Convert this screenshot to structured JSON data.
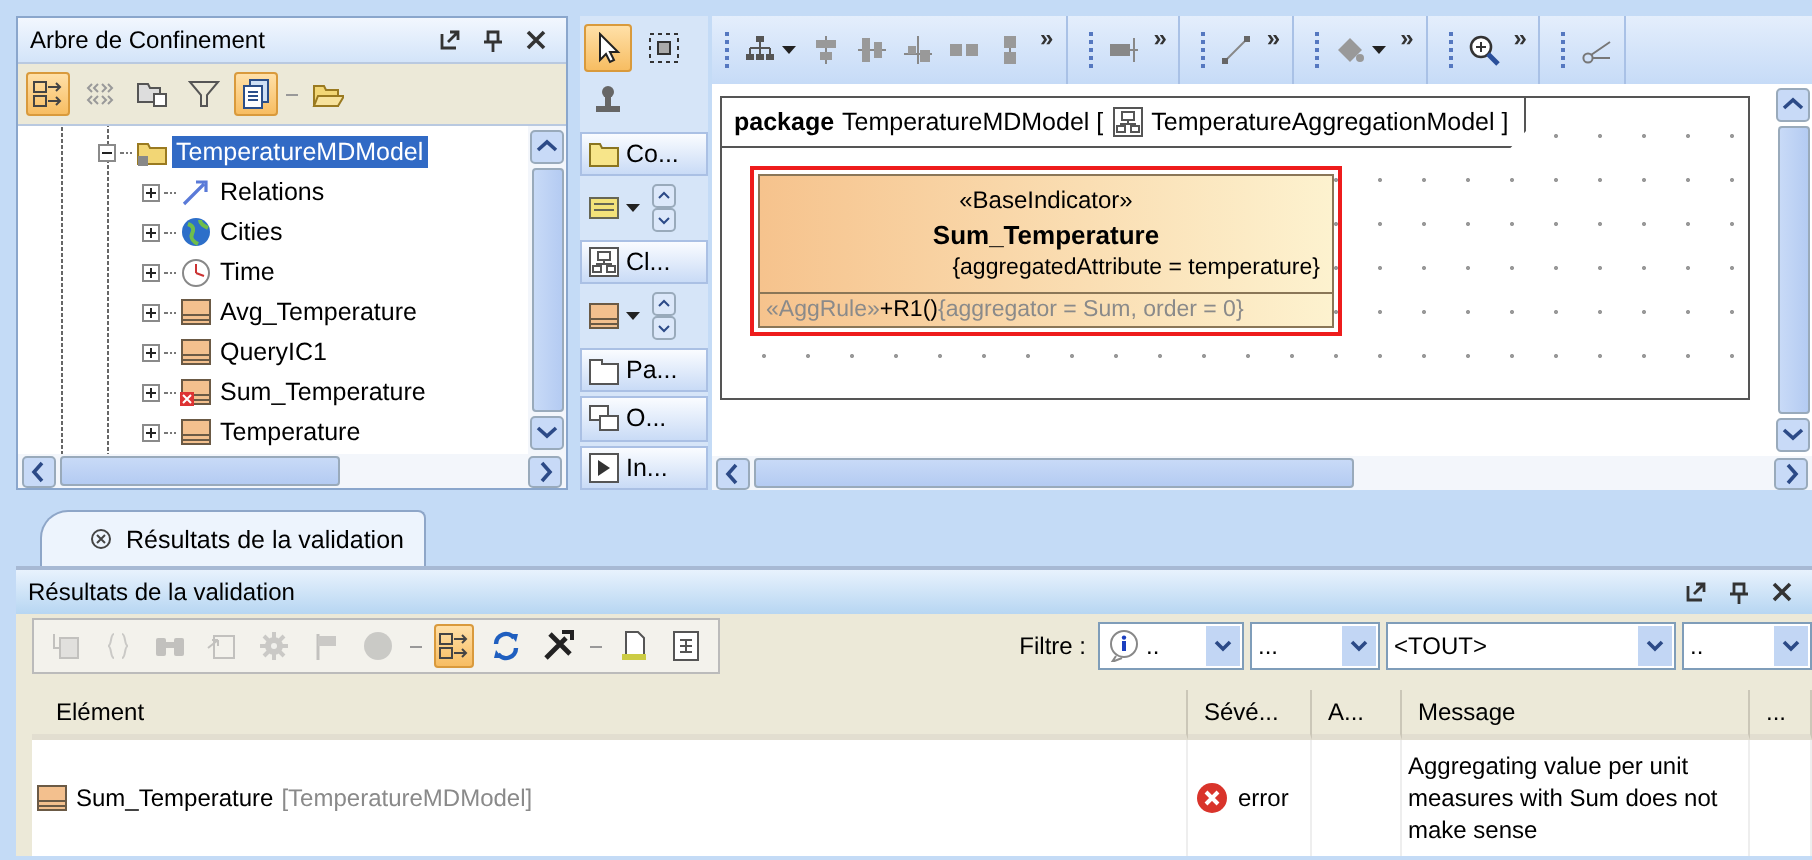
{
  "containment_tree": {
    "title": "Arbre de Confinement",
    "tool_groups": [
      [
        {
          "kind": "split-list",
          "on": true
        },
        {
          "kind": "chevrons",
          "on": false
        },
        {
          "kind": "folder-tree",
          "on": false
        },
        {
          "kind": "filter",
          "on": false
        },
        {
          "kind": "document-stack",
          "on": true
        }
      ],
      [
        {
          "kind": "open-folder",
          "on": false
        }
      ]
    ],
    "items": [
      {
        "label": "TemperatureMDModel",
        "kind": "package",
        "selected": true,
        "expanded": true,
        "children": [
          {
            "label": "Relations",
            "kind": "arrow",
            "selected": false,
            "expanded": false
          },
          {
            "label": "Cities",
            "kind": "globe",
            "selected": false,
            "expanded": false
          },
          {
            "label": "Time",
            "kind": "clock",
            "selected": false,
            "expanded": false
          },
          {
            "label": "Avg_Temperature",
            "kind": "class",
            "selected": false,
            "expanded": false
          },
          {
            "label": "QueryIC1",
            "kind": "class",
            "selected": false,
            "expanded": false
          },
          {
            "label": "Sum_Temperature",
            "kind": "error-class",
            "selected": false,
            "expanded": false
          },
          {
            "label": "Temperature",
            "kind": "class",
            "selected": false,
            "expanded": false
          }
        ]
      }
    ]
  },
  "palette": {
    "tools": [
      {
        "kind": "pointer",
        "selected": true
      },
      {
        "kind": "marquee",
        "selected": false
      },
      {
        "kind": "stamp",
        "selected": false
      }
    ],
    "rows": [
      {
        "kind": "category",
        "label": "Co..."
      },
      {
        "kind": "tool"
      },
      {
        "kind": "category",
        "label": "Cl..."
      },
      {
        "kind": "tool"
      },
      {
        "kind": "category",
        "label": "Pa..."
      },
      {
        "kind": "category",
        "label": "O..."
      },
      {
        "kind": "category",
        "label": "In..."
      }
    ]
  },
  "diagram_toolbar": [
    {
      "tools": [
        {
          "kind": "tree-layout"
        },
        {
          "kind": "align-a"
        },
        {
          "kind": "align-b"
        },
        {
          "kind": "align-c"
        },
        {
          "kind": "align-d"
        },
        {
          "kind": "align-e"
        }
      ],
      "more": "»"
    },
    {
      "tools": [
        {
          "kind": "connector"
        }
      ],
      "more": "»"
    },
    {
      "tools": [
        {
          "kind": "line"
        }
      ],
      "more": "»"
    },
    {
      "tools": [
        {
          "kind": "fill"
        }
      ],
      "more": "»"
    },
    {
      "tools": [
        {
          "kind": "zoom"
        }
      ],
      "more": "»"
    },
    {
      "tools": [
        {
          "kind": "cut"
        }
      ]
    }
  ],
  "diagram": {
    "frame_keyword": "package",
    "frame_name": "TemperatureMDModel [",
    "frame_diagram": "TemperatureAggregationModel ]",
    "element": {
      "selected": true,
      "stereotype": "«BaseIndicator»",
      "name": "Sum_Temperature",
      "tagged_value": "{aggregatedAttribute = temperature}",
      "operation": {
        "stereotype": "«AggRule»",
        "signature": "+R1()",
        "constraint": "{aggregator = Sum, order = 0}"
      }
    }
  },
  "bottom_tabs": [
    {
      "label": "Résultats de la validation",
      "selected": true
    }
  ],
  "validation": {
    "title": "Résultats de la validation",
    "tool_groups": [
      [
        {
          "kind": "tree-doc",
          "disabled": true,
          "on": false
        },
        {
          "kind": "braces",
          "disabled": true,
          "on": false
        },
        {
          "kind": "binoculars",
          "disabled": true,
          "on": false
        },
        {
          "kind": "export",
          "disabled": true,
          "on": false
        },
        {
          "kind": "gear",
          "disabled": true,
          "on": false
        },
        {
          "kind": "flag",
          "disabled": true,
          "on": false
        },
        {
          "kind": "circle",
          "disabled": true,
          "on": false
        }
      ],
      [
        {
          "kind": "split-list",
          "disabled": false,
          "on": true
        },
        {
          "kind": "refresh",
          "disabled": false,
          "on": false
        },
        {
          "kind": "tools",
          "disabled": false,
          "on": false
        }
      ],
      [
        {
          "kind": "document",
          "disabled": false,
          "on": false
        },
        {
          "kind": "sheet",
          "disabled": false,
          "on": false
        }
      ]
    ],
    "filter_label": "Filtre :",
    "filters": [
      {
        "kind": "severity",
        "value": ".."
      },
      {
        "kind": "plain",
        "value": "..."
      },
      {
        "kind": "wide",
        "value": "<TOUT>"
      },
      {
        "kind": "plain",
        "value": ".."
      }
    ],
    "columns": [
      "Elément",
      "Sévé...",
      "A...",
      "Message",
      "..."
    ],
    "rows": [
      {
        "element": "Sum_Temperature",
        "owner": "[TemperatureMDModel]",
        "severity": "error",
        "message": "Aggregating value per unit measures with Sum does not make sense"
      }
    ]
  }
}
